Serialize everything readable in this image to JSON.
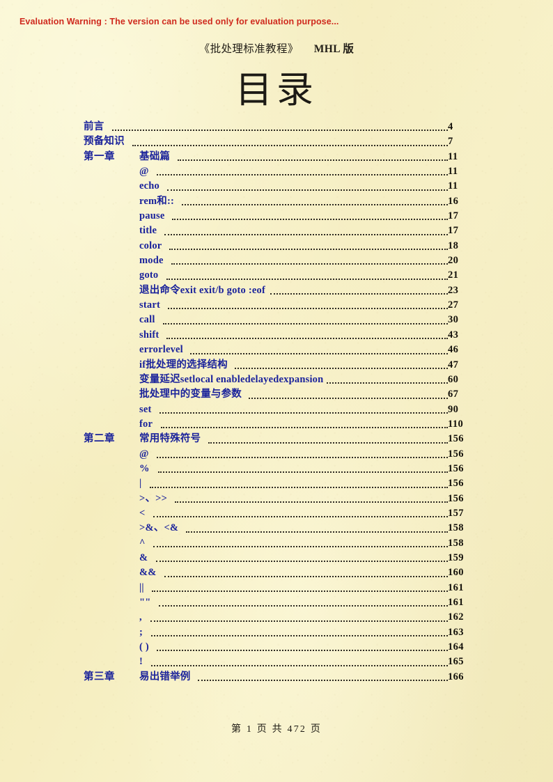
{
  "eval_warning": "Evaluation Warning : The version can be used only for evaluation purpose...",
  "header": {
    "book_title": "《批处理标准教程》",
    "version": "MHL 版"
  },
  "title": "目录",
  "footer": "第 1 页 共 472 页",
  "colors": {
    "page_background": "#f7f1c6",
    "entry_blue": "#1b239b",
    "page_number_black": "#14110b",
    "warning_red": "#cf2a1e",
    "leader_dots": "#2e2a22"
  },
  "toc": {
    "entries": [
      {
        "chapter": "",
        "label": "前言",
        "page": "4",
        "level": 1
      },
      {
        "chapter": "",
        "label": "预备知识",
        "page": "7",
        "level": 1
      },
      {
        "chapter": "第一章",
        "label": "基础篇",
        "page": "11",
        "level": 2
      },
      {
        "chapter": "",
        "label": "@",
        "page": "11",
        "level": 2
      },
      {
        "chapter": "",
        "label": "echo",
        "page": "11",
        "level": 2
      },
      {
        "chapter": "",
        "label": "rem和::",
        "page": "16",
        "level": 2
      },
      {
        "chapter": "",
        "label": "pause",
        "page": "17",
        "level": 2
      },
      {
        "chapter": "",
        "label": "title",
        "page": "17",
        "level": 2
      },
      {
        "chapter": "",
        "label": "color",
        "page": "18",
        "level": 2
      },
      {
        "chapter": "",
        "label": "mode",
        "page": "20",
        "level": 2
      },
      {
        "chapter": "",
        "label": "goto",
        "page": "21",
        "level": 2
      },
      {
        "chapter": "",
        "label": "退出命令exit exit/b goto :eof",
        "page": "23",
        "level": 2
      },
      {
        "chapter": "",
        "label": "start",
        "page": "27",
        "level": 2
      },
      {
        "chapter": "",
        "label": "call",
        "page": "30",
        "level": 2
      },
      {
        "chapter": "",
        "label": "shift",
        "page": "43",
        "level": 2
      },
      {
        "chapter": "",
        "label": "errorlevel",
        "page": "46",
        "level": 2
      },
      {
        "chapter": "",
        "label": "if批处理的选择结构",
        "page": "47",
        "level": 2
      },
      {
        "chapter": "",
        "label": "变量延迟setlocal enabledelayedexpansion",
        "page": "60",
        "level": 2
      },
      {
        "chapter": "",
        "label": "批处理中的变量与参数",
        "page": "67",
        "level": 2
      },
      {
        "chapter": "",
        "label": "set",
        "page": "90",
        "level": 2
      },
      {
        "chapter": "",
        "label": "for",
        "page": "110",
        "level": 2
      },
      {
        "chapter": "第二章",
        "label": "常用特殊符号",
        "page": "156",
        "level": 2
      },
      {
        "chapter": "",
        "label": "@",
        "page": "156",
        "level": 2
      },
      {
        "chapter": "",
        "label": "%",
        "page": "156",
        "level": 2
      },
      {
        "chapter": "",
        "label": "|",
        "page": "156",
        "level": 2
      },
      {
        "chapter": "",
        "label": ">、>>",
        "page": "156",
        "level": 2
      },
      {
        "chapter": "",
        "label": "<",
        "page": "157",
        "level": 2
      },
      {
        "chapter": "",
        "label": ">&、<&",
        "page": "158",
        "level": 2
      },
      {
        "chapter": "",
        "label": "^",
        "page": "158",
        "level": 2
      },
      {
        "chapter": "",
        "label": "&",
        "page": "159",
        "level": 2
      },
      {
        "chapter": "",
        "label": "&&",
        "page": "160",
        "level": 2
      },
      {
        "chapter": "",
        "label": "||",
        "page": "161",
        "level": 2
      },
      {
        "chapter": "",
        "label": "\"\"",
        "page": "161",
        "level": 2
      },
      {
        "chapter": "",
        "label": ",",
        "page": "162",
        "level": 2
      },
      {
        "chapter": "",
        "label": ";",
        "page": "163",
        "level": 2
      },
      {
        "chapter": "",
        "label": "( )",
        "page": "164",
        "level": 2
      },
      {
        "chapter": "",
        "label": "!",
        "page": "165",
        "level": 2
      },
      {
        "chapter": "第三章",
        "label": "易出错举例",
        "page": "166",
        "level": 2
      }
    ]
  }
}
